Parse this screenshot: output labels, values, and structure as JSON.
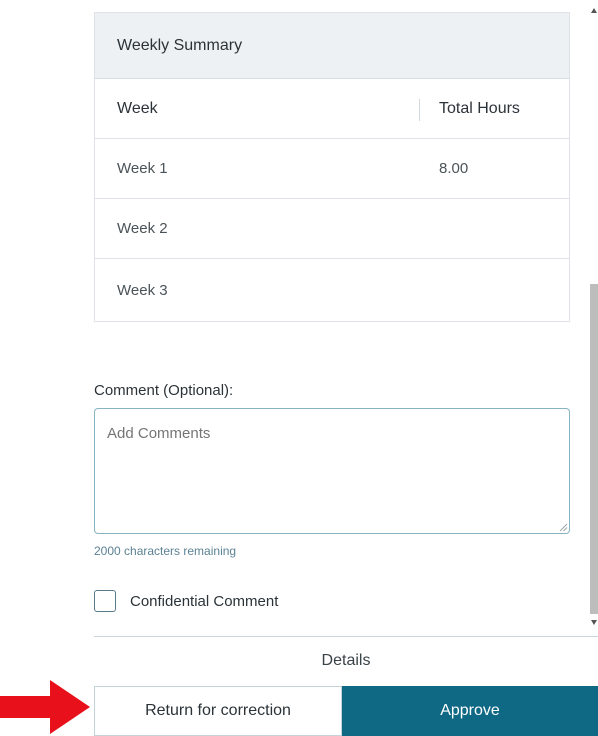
{
  "summary": {
    "title": "Weekly Summary",
    "columns": [
      "Week",
      "Total Hours"
    ],
    "rows": [
      {
        "week": "Week 1",
        "hours": "8.00"
      },
      {
        "week": "Week 2",
        "hours": ""
      },
      {
        "week": "Week 3",
        "hours": ""
      }
    ]
  },
  "comment": {
    "label": "Comment (Optional):",
    "placeholder": "Add Comments",
    "remaining": "2000 characters remaining"
  },
  "confidential": {
    "label": "Confidential Comment",
    "checked": false
  },
  "footer": {
    "details_label": "Details",
    "return_label": "Return for correction",
    "approve_label": "Approve"
  },
  "colors": {
    "approve_bg": "#0f6884",
    "arrow": "#e8101a"
  }
}
